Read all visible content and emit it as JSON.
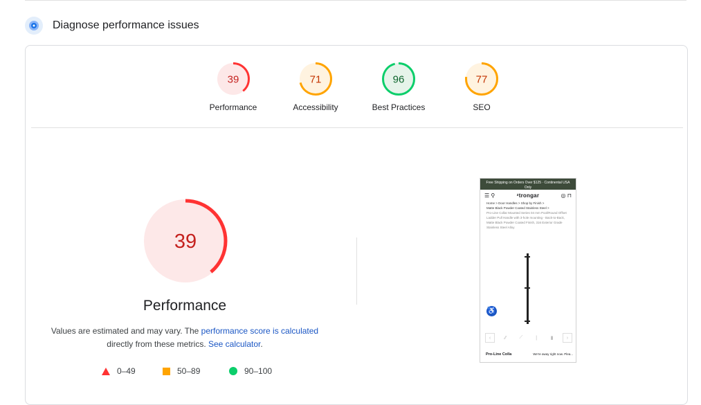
{
  "section": {
    "title": "Diagnose performance issues",
    "icon": "lighthouse-icon"
  },
  "categories": [
    {
      "label": "Performance",
      "score": "39",
      "color": "#f33",
      "text_color": "#c5221f",
      "bg": "#fde8e8",
      "fraction": 0.39
    },
    {
      "label": "Accessibility",
      "score": "71",
      "color": "#ffa400",
      "text_color": "#c33300",
      "bg": "#fff3e0",
      "fraction": 0.71
    },
    {
      "label": "Best Practices",
      "score": "96",
      "color": "#0cce6b",
      "text_color": "#0d652d",
      "bg": "#e6f4ea",
      "fraction": 0.96
    },
    {
      "label": "SEO",
      "score": "77",
      "color": "#ffa400",
      "text_color": "#c33300",
      "bg": "#fff3e0",
      "fraction": 0.77
    }
  ],
  "main": {
    "score": "39",
    "fraction": 0.39,
    "title": "Performance",
    "desc_prefix": "Values are estimated and may vary. The ",
    "desc_link": "performance score is calculated",
    "desc_mid": " directly from these metrics. ",
    "desc_link2": "See calculator",
    "desc_suffix": "."
  },
  "legend": [
    {
      "range": "0–49",
      "shape": "triangle",
      "color": "#f33"
    },
    {
      "range": "50–89",
      "shape": "square",
      "color": "#ffa400"
    },
    {
      "range": "90–100",
      "shape": "circle",
      "color": "#0cce6b"
    }
  ],
  "screenshot": {
    "banner": "Free Shipping on Orders Over $125 · Continental USA Only",
    "logo": "ᶻtrongar",
    "breadcrumb": "Home > Door Handles > Shop by Finish >",
    "breadcrumb2": "Matte Black Powder Coated Stainless Steel >",
    "desc": "Pro-Line Collar Mounted Series 04 mm Pool/Round Offset Ladder Pull Handle with 3-hole mounting - Back-to-Back, Matte Black Powder Coated Finish, 316 Exterior Grade Stainless Steel Alloy",
    "footer_left": "Pro-Line Colla",
    "footer_chat": "We're away right now. Plea..."
  }
}
